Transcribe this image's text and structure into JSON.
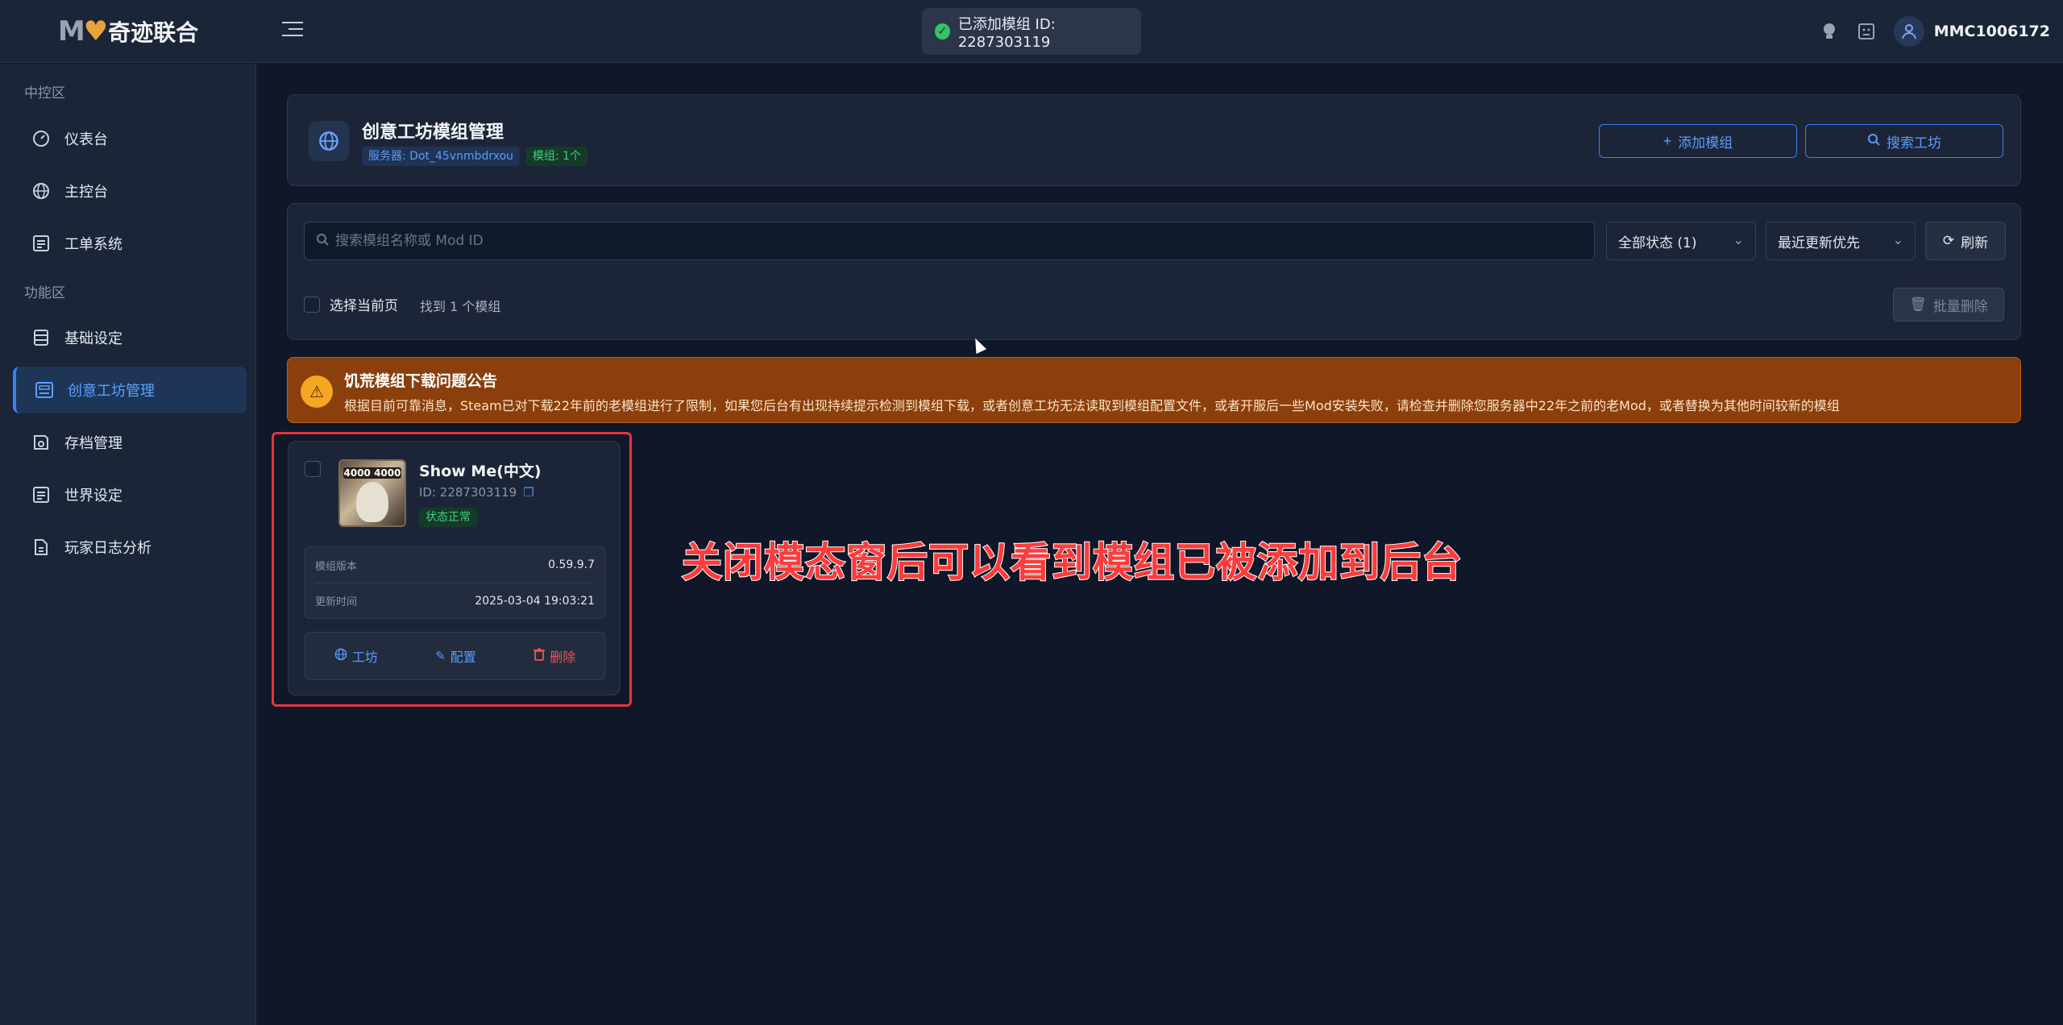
{
  "app": {
    "logo_mark": "M",
    "logo_text": "奇迹联合",
    "username": "MMC1006172"
  },
  "toast": {
    "text": "已添加模组 ID: 2287303119"
  },
  "sidebar": {
    "sections": [
      {
        "label": "中控区"
      },
      {
        "label": "功能区"
      }
    ],
    "items": [
      {
        "label": "仪表台",
        "icon": "gauge-icon"
      },
      {
        "label": "主控台",
        "icon": "globe-icon"
      },
      {
        "label": "工单系统",
        "icon": "list-icon"
      },
      {
        "label": "基础设定",
        "icon": "server-icon"
      },
      {
        "label": "创意工坊管理",
        "icon": "workshop-icon",
        "active": true
      },
      {
        "label": "存档管理",
        "icon": "save-icon"
      },
      {
        "label": "世界设定",
        "icon": "list-icon"
      },
      {
        "label": "玩家日志分析",
        "icon": "document-icon"
      }
    ]
  },
  "header": {
    "title": "创意工坊模组管理",
    "server_badge": "服务器: Dot_45vnmbdrxou",
    "mod_count_badge": "模组: 1个",
    "add_mod_label": "添加模组",
    "search_workshop_label": "搜索工坊"
  },
  "filters": {
    "search_placeholder": "搜索模组名称或 Mod ID",
    "search_value": "",
    "status_select": "全部状态 (1)",
    "sort_select": "最近更新优先",
    "refresh_label": "刷新",
    "select_page_label": "选择当前页",
    "found_text": "找到 1 个模组",
    "batch_delete_label": "批量删除"
  },
  "notice": {
    "title": "饥荒模组下载问题公告",
    "body": "根据目前可靠消息，Steam已对下载22年前的老模组进行了限制，如果您后台有出现持续提示检测到模组下载，或者创意工坊无法读取到模组配置文件，或者开服后一些Mod安装失败，请检查并删除您服务器中22年之前的老Mod，或者替换为其他时间较新的模组"
  },
  "mod": {
    "thumb_text": "4000 4000",
    "name": "Show Me(中文)",
    "id_text": "ID: 2287303119",
    "status": "状态正常",
    "version_label": "模组版本",
    "version_value": "0.59.9.7",
    "updated_label": "更新时间",
    "updated_value": "2025-03-04 19:03:21",
    "workshop_label": "工坊",
    "config_label": "配置",
    "delete_label": "删除"
  },
  "annotation": {
    "text": "关闭模态窗后可以看到模组已被添加到后台"
  },
  "colors": {
    "accent": "#3a82f0",
    "success": "#3fcf7d",
    "danger": "#f05252",
    "warning_bg": "#8a3f0d",
    "annotation": "#ff3b3b"
  }
}
